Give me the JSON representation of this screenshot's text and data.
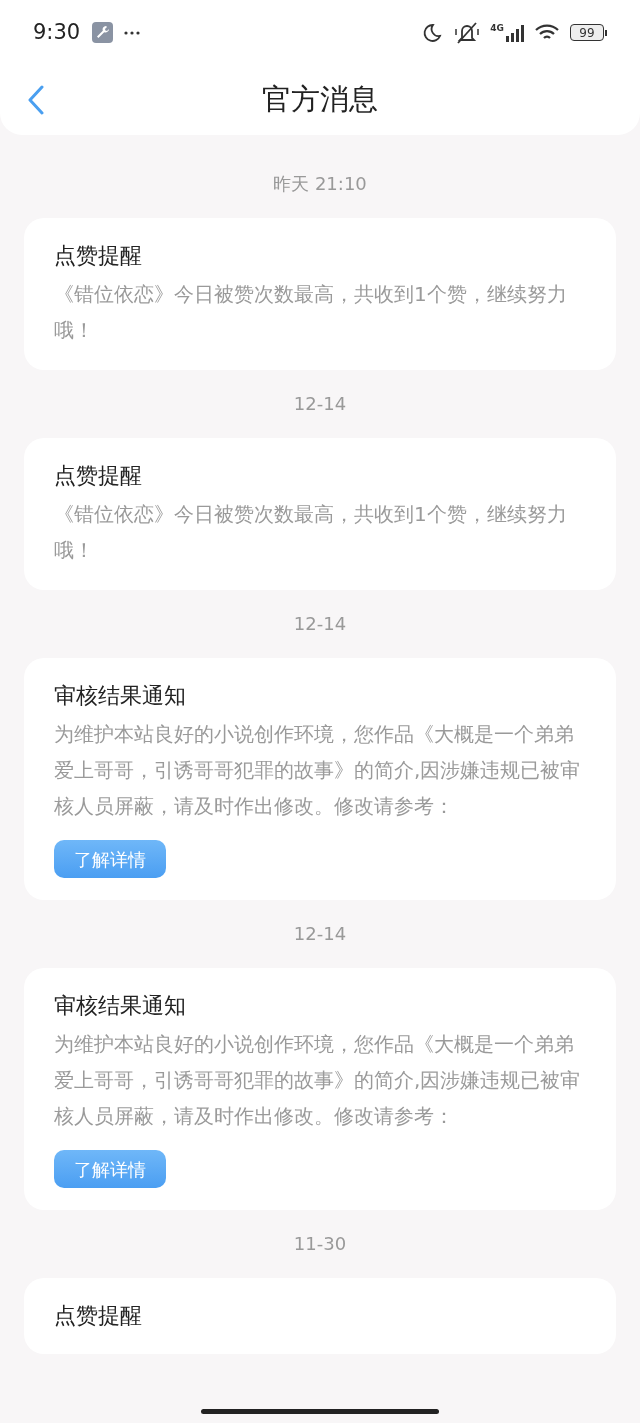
{
  "status_bar": {
    "time": "9:30",
    "network": "4G",
    "battery": "99"
  },
  "header": {
    "title": "官方消息"
  },
  "messages": [
    {
      "date": "昨天 21:10",
      "title": "点赞提醒",
      "body": "《错位依恋》今日被赞次数最高，共收到1个赞，继续努力哦！"
    },
    {
      "date": "12-14",
      "title": "点赞提醒",
      "body": "《错位依恋》今日被赞次数最高，共收到1个赞，继续努力哦！"
    },
    {
      "date": "12-14",
      "title": "审核结果通知",
      "body": "为维护本站良好的小说创作环境，您作品《大概是一个弟弟爱上哥哥，引诱哥哥犯罪的故事》的简介,因涉嫌违规已被审核人员屏蔽，请及时作出修改。修改请参考：",
      "button": "了解详情"
    },
    {
      "date": "12-14",
      "title": "审核结果通知",
      "body": "为维护本站良好的小说创作环境，您作品《大概是一个弟弟爱上哥哥，引诱哥哥犯罪的故事》的简介,因涉嫌违规已被审核人员屏蔽，请及时作出修改。修改请参考：",
      "button": "了解详情"
    },
    {
      "date": "11-30",
      "title": "点赞提醒"
    }
  ]
}
